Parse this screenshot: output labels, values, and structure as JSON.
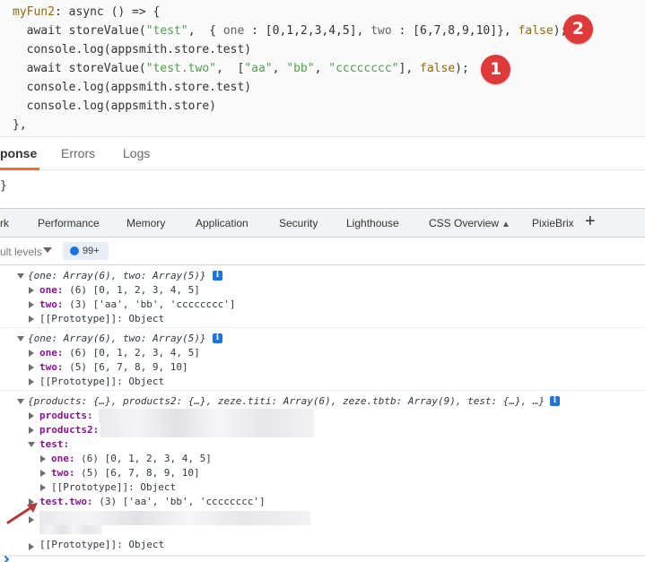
{
  "code_editor": {
    "lines": [
      {
        "parts": [
          {
            "t": "myFun2",
            "c": "c-prop"
          },
          {
            "t": ": async () => {",
            "c": ""
          }
        ]
      },
      {
        "parts": [
          {
            "t": "  await storeValue(",
            "c": ""
          },
          {
            "t": "\"test\"",
            "c": "c-str"
          },
          {
            "t": ",  { ",
            "c": ""
          },
          {
            "t": "one",
            "c": "c-key"
          },
          {
            "t": " : [0,1,2,3,4,5], ",
            "c": ""
          },
          {
            "t": "two",
            "c": "c-key"
          },
          {
            "t": " : [6,7,8,9,10]}, ",
            "c": ""
          },
          {
            "t": "false",
            "c": "c-lit"
          },
          {
            "t": ");",
            "c": ""
          }
        ]
      },
      {
        "parts": [
          {
            "t": "  console.log(appsmith.store.test)",
            "c": ""
          }
        ]
      },
      {
        "parts": [
          {
            "t": "  await storeValue(",
            "c": ""
          },
          {
            "t": "\"test.two\"",
            "c": "c-str"
          },
          {
            "t": ",  [",
            "c": ""
          },
          {
            "t": "\"aa\"",
            "c": "c-str"
          },
          {
            "t": ", ",
            "c": ""
          },
          {
            "t": "\"bb\"",
            "c": "c-str"
          },
          {
            "t": ", ",
            "c": ""
          },
          {
            "t": "\"cccccccc\"",
            "c": "c-str"
          },
          {
            "t": "], ",
            "c": ""
          },
          {
            "t": "false",
            "c": "c-lit"
          },
          {
            "t": ");",
            "c": ""
          }
        ]
      },
      {
        "parts": [
          {
            "t": "  console.log(appsmith.store.test)",
            "c": ""
          }
        ]
      },
      {
        "parts": [
          {
            "t": "  console.log(appsmith.store)",
            "c": ""
          }
        ]
      },
      {
        "parts": [
          {
            "t": "},",
            "c": ""
          }
        ]
      }
    ],
    "badges": [
      "2",
      "1"
    ]
  },
  "response_tabs": [
    "ponse",
    "Errors",
    "Logs"
  ],
  "response_body": "}",
  "devtools_tabs": [
    "rk",
    "Performance",
    "Memory",
    "Application",
    "Security",
    "Lighthouse",
    "CSS Overview",
    "PixieBrix"
  ],
  "console_toolbar": {
    "levels": "ult levels",
    "issues_count": "99+"
  },
  "messages": [
    {
      "preview": "{one: Array(6), two: Array(5)}",
      "rows": [
        {
          "key": "one:",
          "val": " (6) [0, 1, 2, 3, 4, 5]"
        },
        {
          "key": "two:",
          "val": " (3) ['aa', 'bb', 'cccccccc']"
        },
        {
          "key": "",
          "val": "[[Prototype]]: Object"
        }
      ]
    },
    {
      "preview": "{one: Array(6), two: Array(5)}",
      "rows": [
        {
          "key": "one:",
          "val": " (6) [0, 1, 2, 3, 4, 5]"
        },
        {
          "key": "two:",
          "val": " (5) [6, 7, 8, 9, 10]"
        },
        {
          "key": "",
          "val": "[[Prototype]]: Object"
        }
      ]
    },
    {
      "preview": "{products: {…}, products2: {…}, zeze.titi: Array(6), zeze.tbtb: Array(9), test: {…}, …}",
      "rows": [
        {
          "key": "products:",
          "val": ""
        },
        {
          "key": "products2:",
          "val": ""
        },
        {
          "key": "test:",
          "val": ""
        },
        {
          "key": "one:",
          "val": " (6) [0, 1, 2, 3, 4, 5]"
        },
        {
          "key": "two:",
          "val": " (5) [6, 7, 8, 9, 10]"
        },
        {
          "key": "",
          "val": "[[Prototype]]: Object"
        },
        {
          "key": "test.two:",
          "val": " (3) ['aa', 'bb', 'cccccccc']"
        },
        {
          "key": "",
          "val": ""
        },
        {
          "key": "",
          "val": "[[Prototype]]: Object"
        }
      ]
    }
  ]
}
